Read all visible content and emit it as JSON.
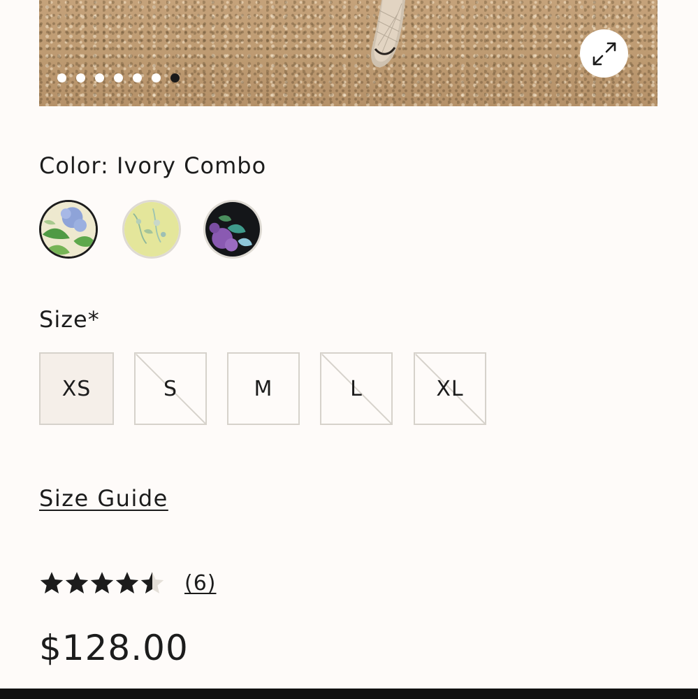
{
  "hero": {
    "slide_count": 7,
    "active_slide": 7,
    "expand_icon": "expand-arrows-icon"
  },
  "color": {
    "label": "Color: Ivory Combo",
    "swatches": [
      {
        "name": "Ivory Combo",
        "selected": true
      },
      {
        "name": "Yellow floral",
        "selected": false
      },
      {
        "name": "Black floral",
        "selected": false
      }
    ]
  },
  "size": {
    "label": "Size*",
    "options": [
      {
        "label": "XS",
        "available": true,
        "selected": true
      },
      {
        "label": "S",
        "available": false,
        "selected": false
      },
      {
        "label": "M",
        "available": true,
        "selected": false
      },
      {
        "label": "L",
        "available": false,
        "selected": false
      },
      {
        "label": "XL",
        "available": false,
        "selected": false
      }
    ]
  },
  "size_guide": {
    "label": "Size Guide"
  },
  "rating": {
    "value": 4.5,
    "max": 5,
    "count_label": "(6)"
  },
  "price": {
    "label": "$128.00"
  },
  "colors": {
    "background": "#fefbf9",
    "text": "#1c1c1c",
    "border": "#d6d2cb",
    "selected_size_bg": "#f5efe9"
  }
}
